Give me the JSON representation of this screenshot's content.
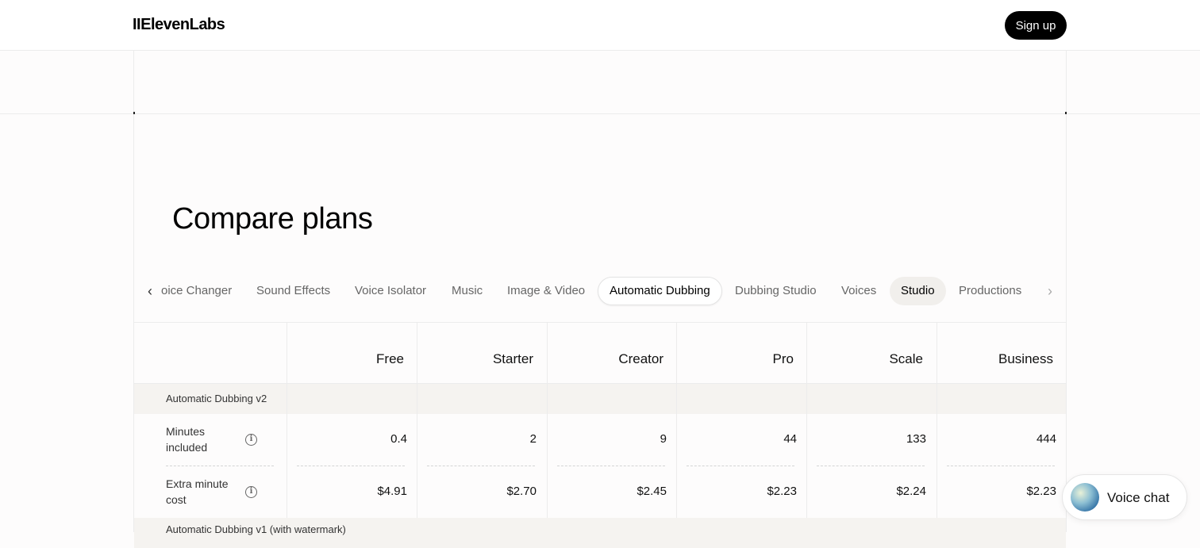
{
  "header": {
    "logo": "IIElevenLabs",
    "signup_label": "Sign up"
  },
  "page": {
    "title": "Compare plans"
  },
  "tabs": {
    "items": [
      {
        "label": "oice Changer",
        "state": "normal"
      },
      {
        "label": "Sound Effects",
        "state": "normal"
      },
      {
        "label": "Voice Isolator",
        "state": "normal"
      },
      {
        "label": "Music",
        "state": "normal"
      },
      {
        "label": "Image & Video",
        "state": "normal"
      },
      {
        "label": "Automatic Dubbing",
        "state": "active"
      },
      {
        "label": "Dubbing Studio",
        "state": "normal"
      },
      {
        "label": "Voices",
        "state": "normal"
      },
      {
        "label": "Studio",
        "state": "highlight"
      },
      {
        "label": "Productions",
        "state": "normal"
      }
    ],
    "prev_icon": "chevron-left-icon",
    "next_icon": "chevron-right-icon"
  },
  "table": {
    "plans": [
      "Free",
      "Starter",
      "Creator",
      "Pro",
      "Scale",
      "Business"
    ],
    "sections": [
      {
        "title": "Automatic Dubbing v2",
        "rows": [
          {
            "label": "Minutes included",
            "values": [
              "0.4",
              "2",
              "9",
              "44",
              "133",
              "444"
            ]
          },
          {
            "label": "Extra minute cost",
            "values": [
              "$4.91",
              "$2.70",
              "$2.45",
              "$2.23",
              "$2.24",
              "$2.23"
            ]
          }
        ]
      },
      {
        "title": "Automatic Dubbing v1 (with watermark)",
        "rows": []
      }
    ]
  },
  "voice_chat": {
    "label": "Voice chat"
  },
  "colors": {
    "accent": "#000000",
    "background": "#fdfcfc",
    "section_bg": "#f5f3f0"
  }
}
